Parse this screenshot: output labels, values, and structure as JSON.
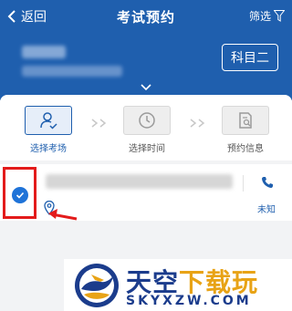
{
  "navbar": {
    "back_label": "返回",
    "title": "考试预约",
    "filter_label": "筛选"
  },
  "header": {
    "subject_badge": "科目二"
  },
  "steps": [
    {
      "label": "选择考场"
    },
    {
      "label": "选择时间"
    },
    {
      "label": "预约信息"
    }
  ],
  "venue": {
    "status_label": "未知"
  },
  "watermark": {
    "brand_main": "天空",
    "brand_accent": "下载玩",
    "url": "SKYXZW.COM"
  },
  "colors": {
    "header_blue": "#1f5fae",
    "check_blue": "#1f73d8",
    "highlight_red": "#e31b1b"
  }
}
